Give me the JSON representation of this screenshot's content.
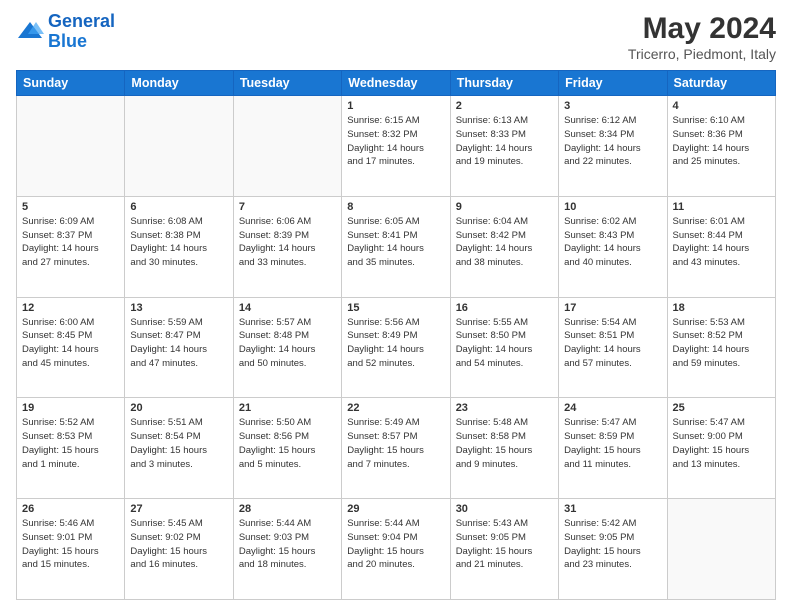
{
  "header": {
    "logo_line1": "General",
    "logo_line2": "Blue",
    "month_year": "May 2024",
    "location": "Tricerro, Piedmont, Italy"
  },
  "days_of_week": [
    "Sunday",
    "Monday",
    "Tuesday",
    "Wednesday",
    "Thursday",
    "Friday",
    "Saturday"
  ],
  "weeks": [
    [
      {
        "day": "",
        "info": ""
      },
      {
        "day": "",
        "info": ""
      },
      {
        "day": "",
        "info": ""
      },
      {
        "day": "1",
        "info": "Sunrise: 6:15 AM\nSunset: 8:32 PM\nDaylight: 14 hours\nand 17 minutes."
      },
      {
        "day": "2",
        "info": "Sunrise: 6:13 AM\nSunset: 8:33 PM\nDaylight: 14 hours\nand 19 minutes."
      },
      {
        "day": "3",
        "info": "Sunrise: 6:12 AM\nSunset: 8:34 PM\nDaylight: 14 hours\nand 22 minutes."
      },
      {
        "day": "4",
        "info": "Sunrise: 6:10 AM\nSunset: 8:36 PM\nDaylight: 14 hours\nand 25 minutes."
      }
    ],
    [
      {
        "day": "5",
        "info": "Sunrise: 6:09 AM\nSunset: 8:37 PM\nDaylight: 14 hours\nand 27 minutes."
      },
      {
        "day": "6",
        "info": "Sunrise: 6:08 AM\nSunset: 8:38 PM\nDaylight: 14 hours\nand 30 minutes."
      },
      {
        "day": "7",
        "info": "Sunrise: 6:06 AM\nSunset: 8:39 PM\nDaylight: 14 hours\nand 33 minutes."
      },
      {
        "day": "8",
        "info": "Sunrise: 6:05 AM\nSunset: 8:41 PM\nDaylight: 14 hours\nand 35 minutes."
      },
      {
        "day": "9",
        "info": "Sunrise: 6:04 AM\nSunset: 8:42 PM\nDaylight: 14 hours\nand 38 minutes."
      },
      {
        "day": "10",
        "info": "Sunrise: 6:02 AM\nSunset: 8:43 PM\nDaylight: 14 hours\nand 40 minutes."
      },
      {
        "day": "11",
        "info": "Sunrise: 6:01 AM\nSunset: 8:44 PM\nDaylight: 14 hours\nand 43 minutes."
      }
    ],
    [
      {
        "day": "12",
        "info": "Sunrise: 6:00 AM\nSunset: 8:45 PM\nDaylight: 14 hours\nand 45 minutes."
      },
      {
        "day": "13",
        "info": "Sunrise: 5:59 AM\nSunset: 8:47 PM\nDaylight: 14 hours\nand 47 minutes."
      },
      {
        "day": "14",
        "info": "Sunrise: 5:57 AM\nSunset: 8:48 PM\nDaylight: 14 hours\nand 50 minutes."
      },
      {
        "day": "15",
        "info": "Sunrise: 5:56 AM\nSunset: 8:49 PM\nDaylight: 14 hours\nand 52 minutes."
      },
      {
        "day": "16",
        "info": "Sunrise: 5:55 AM\nSunset: 8:50 PM\nDaylight: 14 hours\nand 54 minutes."
      },
      {
        "day": "17",
        "info": "Sunrise: 5:54 AM\nSunset: 8:51 PM\nDaylight: 14 hours\nand 57 minutes."
      },
      {
        "day": "18",
        "info": "Sunrise: 5:53 AM\nSunset: 8:52 PM\nDaylight: 14 hours\nand 59 minutes."
      }
    ],
    [
      {
        "day": "19",
        "info": "Sunrise: 5:52 AM\nSunset: 8:53 PM\nDaylight: 15 hours\nand 1 minute."
      },
      {
        "day": "20",
        "info": "Sunrise: 5:51 AM\nSunset: 8:54 PM\nDaylight: 15 hours\nand 3 minutes."
      },
      {
        "day": "21",
        "info": "Sunrise: 5:50 AM\nSunset: 8:56 PM\nDaylight: 15 hours\nand 5 minutes."
      },
      {
        "day": "22",
        "info": "Sunrise: 5:49 AM\nSunset: 8:57 PM\nDaylight: 15 hours\nand 7 minutes."
      },
      {
        "day": "23",
        "info": "Sunrise: 5:48 AM\nSunset: 8:58 PM\nDaylight: 15 hours\nand 9 minutes."
      },
      {
        "day": "24",
        "info": "Sunrise: 5:47 AM\nSunset: 8:59 PM\nDaylight: 15 hours\nand 11 minutes."
      },
      {
        "day": "25",
        "info": "Sunrise: 5:47 AM\nSunset: 9:00 PM\nDaylight: 15 hours\nand 13 minutes."
      }
    ],
    [
      {
        "day": "26",
        "info": "Sunrise: 5:46 AM\nSunset: 9:01 PM\nDaylight: 15 hours\nand 15 minutes."
      },
      {
        "day": "27",
        "info": "Sunrise: 5:45 AM\nSunset: 9:02 PM\nDaylight: 15 hours\nand 16 minutes."
      },
      {
        "day": "28",
        "info": "Sunrise: 5:44 AM\nSunset: 9:03 PM\nDaylight: 15 hours\nand 18 minutes."
      },
      {
        "day": "29",
        "info": "Sunrise: 5:44 AM\nSunset: 9:04 PM\nDaylight: 15 hours\nand 20 minutes."
      },
      {
        "day": "30",
        "info": "Sunrise: 5:43 AM\nSunset: 9:05 PM\nDaylight: 15 hours\nand 21 minutes."
      },
      {
        "day": "31",
        "info": "Sunrise: 5:42 AM\nSunset: 9:05 PM\nDaylight: 15 hours\nand 23 minutes."
      },
      {
        "day": "",
        "info": ""
      }
    ]
  ]
}
